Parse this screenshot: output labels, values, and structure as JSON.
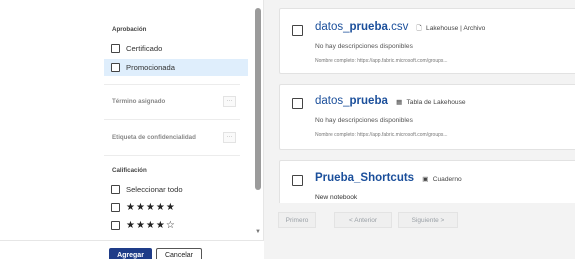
{
  "filters": {
    "approval": {
      "title": "Aprobación",
      "options": [
        {
          "label": "Certificado",
          "selected": false
        },
        {
          "label": "Promocionada",
          "selected": true
        }
      ]
    },
    "assigned_term": {
      "title": "Término asignado",
      "button": "···"
    },
    "sensitivity": {
      "title": "Etiqueta de confidencialidad",
      "button": "···"
    },
    "rating": {
      "title": "Calificación",
      "select_all": "Seleccionar todo",
      "five_stars": "★★★★★",
      "four_stars": "★★★★☆"
    },
    "scroll_arrow": "▼",
    "actions": {
      "add": "Agregar",
      "cancel": "Cancelar"
    }
  },
  "results": [
    {
      "name_prefix": "datos_",
      "name_bold": "prueba",
      "name_suffix": ".csv",
      "type_icon": "file-icon",
      "type_glyph": "🗋",
      "type_label": "Lakehouse | Archivo",
      "description": "No hay descripciones disponibles",
      "full_name": "Nombre completo: https://app.fabric.microsoft.com/groups..."
    },
    {
      "name_prefix": "datos_",
      "name_bold": "prueba",
      "name_suffix": "",
      "type_icon": "table-icon",
      "type_glyph": "▦",
      "type_label": "Tabla de Lakehouse",
      "description": "No hay descripciones disponibles",
      "full_name": "Nombre completo: https://app.fabric.microsoft.com/groups..."
    },
    {
      "name_prefix": "",
      "name_bold": "Prueba",
      "name_suffix": "_Shortcuts",
      "type_icon": "notebook-icon",
      "type_glyph": "▣",
      "type_label": "Cuaderno",
      "description": "New notebook",
      "full_name": ""
    }
  ],
  "pager": {
    "first": "Primero",
    "previous": "< Anterior",
    "next": "Siguiente >"
  }
}
